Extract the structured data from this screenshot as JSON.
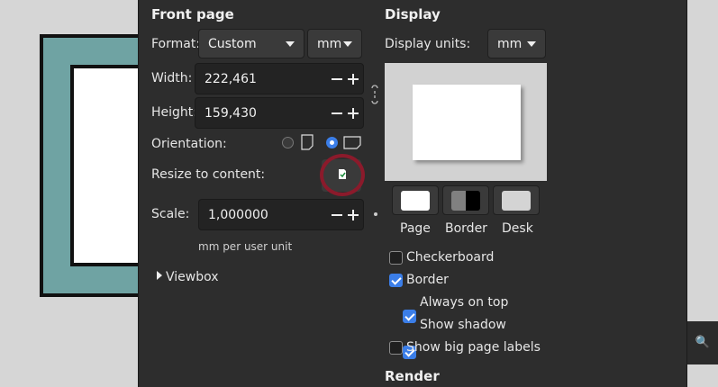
{
  "front_page": {
    "heading": "Front page",
    "format_label": "Format:",
    "format_value": "Custom",
    "format_units": "mm",
    "width_label": "Width:",
    "width_value": "222,461",
    "height_label": "Height:",
    "height_value": "159,430",
    "orientation_label": "Orientation:",
    "resize_label": "Resize to content:",
    "scale_label": "Scale:",
    "scale_value": "1,000000",
    "scale_unit_note": "mm per user unit",
    "viewbox_label": "Viewbox"
  },
  "display": {
    "heading": "Display",
    "units_label": "Display units:",
    "units_value": "mm",
    "swatches": [
      {
        "label": "Page"
      },
      {
        "label": "Border"
      },
      {
        "label": "Desk"
      }
    ],
    "options": [
      {
        "label": "Checkerboard",
        "checked": false
      },
      {
        "label": "Border",
        "checked": true
      },
      {
        "label": "Always on top",
        "checked": true
      },
      {
        "label": "Show shadow",
        "checked": true
      },
      {
        "label": "Show big page labels",
        "checked": false
      }
    ]
  },
  "render": {
    "heading": "Render"
  },
  "colors": {
    "panel_bg": "#2d2d2d",
    "accent": "#3b7ee8",
    "highlight_ring": "#8b1a2b",
    "canvas_page_fill": "#6fa3a3"
  }
}
